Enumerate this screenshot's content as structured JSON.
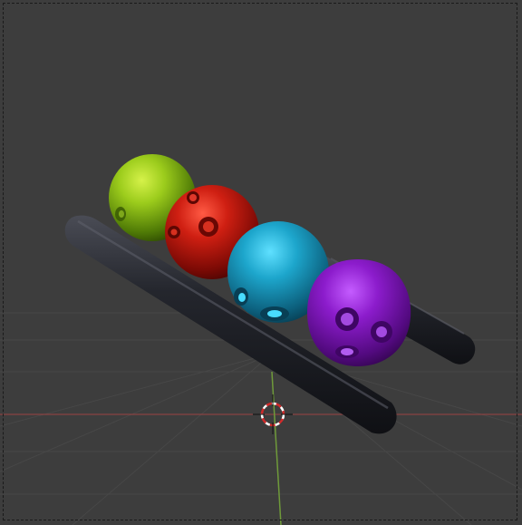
{
  "app": "3D viewport",
  "viewport": {
    "background": "#3d3d3d",
    "grid_color": "#4a4a4a",
    "x_axis_color": "#b54646",
    "y_axis_color": "#6f9a3a",
    "cursor_icon": "3d-cursor-icon"
  },
  "scene_objects": [
    {
      "name": "rail-back",
      "type": "capsule",
      "color": "#1e1f25"
    },
    {
      "name": "rail-front",
      "type": "capsule",
      "color": "#1e1f25"
    },
    {
      "name": "ball-green",
      "type": "sphere",
      "color": "#8fc21b"
    },
    {
      "name": "ball-red",
      "type": "sphere",
      "color": "#c51c12"
    },
    {
      "name": "ball-cyan",
      "type": "sphere",
      "color": "#1ba2c8"
    },
    {
      "name": "ball-purple",
      "type": "sphere",
      "color": "#8a18c8"
    }
  ]
}
